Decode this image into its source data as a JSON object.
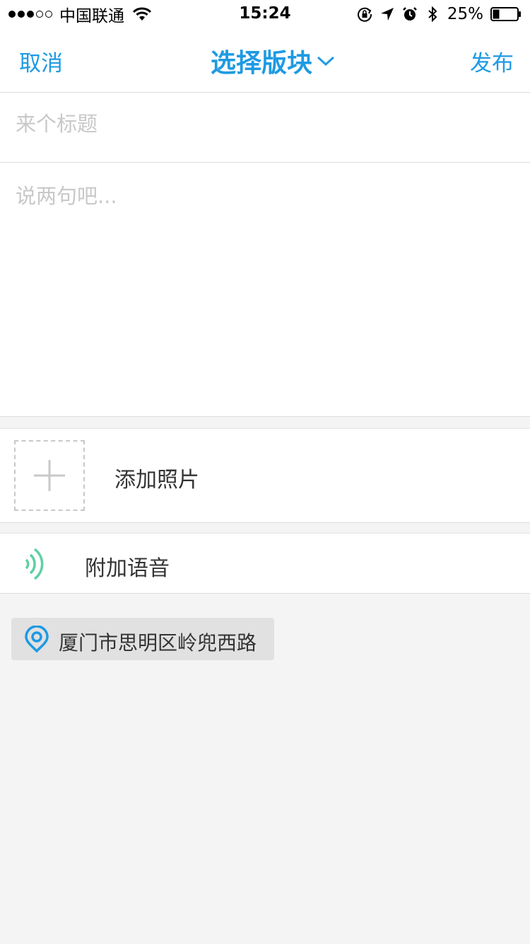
{
  "status_bar": {
    "carrier": "中国联通",
    "time": "15:24",
    "battery_percent": "25%",
    "battery_level": 0.25,
    "signal_strength": 3,
    "signal_max": 5,
    "icons": [
      "wifi-icon",
      "rotation-lock-icon",
      "location-arrow-icon",
      "alarm-icon",
      "bluetooth-icon",
      "battery-icon"
    ]
  },
  "nav": {
    "cancel_label": "取消",
    "title": "选择版块",
    "publish_label": "发布"
  },
  "compose": {
    "title_placeholder": "来个标题",
    "title_value": "",
    "body_placeholder": "说两句吧...",
    "body_value": ""
  },
  "attachments": {
    "photo_label": "添加照片",
    "voice_label": "附加语音"
  },
  "location": {
    "text": "厦门市思明区岭兜西路"
  },
  "colors": {
    "accent": "#1e9ae3",
    "voice_icon": "#5fd0a5",
    "background": "#f4f4f4"
  }
}
